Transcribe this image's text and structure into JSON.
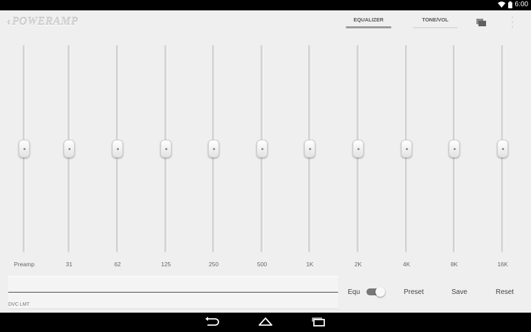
{
  "status": {
    "time": "6:00"
  },
  "app": {
    "back_glyph": "‹",
    "logo": "POWERAMP"
  },
  "tabs": [
    {
      "label": "EQUALIZER",
      "active": true
    },
    {
      "label": "TONE/VOL",
      "active": false
    }
  ],
  "icons": {
    "wifi": "wifi-icon",
    "battery": "battery-icon",
    "folder": "folder-icon",
    "overflow": "more-vert-icon",
    "back": "back-icon",
    "home": "home-icon",
    "recents": "recents-icon"
  },
  "bands": [
    {
      "label": "Preamp",
      "level": 0.5
    },
    {
      "label": "31",
      "level": 0.5
    },
    {
      "label": "62",
      "level": 0.5
    },
    {
      "label": "125",
      "level": 0.5
    },
    {
      "label": "250",
      "level": 0.5
    },
    {
      "label": "500",
      "level": 0.5
    },
    {
      "label": "1K",
      "level": 0.5
    },
    {
      "label": "2K",
      "level": 0.5
    },
    {
      "label": "4K",
      "level": 0.5
    },
    {
      "label": "8K",
      "level": 0.5
    },
    {
      "label": "16K",
      "level": 0.5
    }
  ],
  "dvc": {
    "label": "DVC LMT"
  },
  "controls": {
    "equ_label": "Equ",
    "equ_enabled": true,
    "preset_label": "Preset",
    "save_label": "Save",
    "reset_label": "Reset"
  },
  "colors": {
    "background": "#efefef",
    "track": "#dcdcdc",
    "tab_active_underline": "#9a9a9a",
    "toggle_on": "#777777"
  }
}
